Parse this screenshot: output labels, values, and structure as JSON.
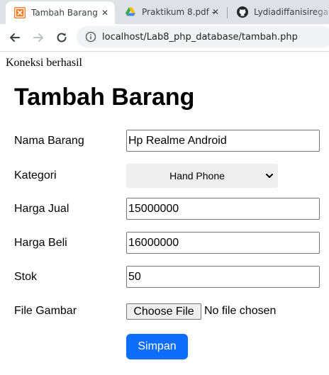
{
  "browser": {
    "tabs": [
      {
        "title": "Tambah Barang",
        "icon": "xampp-icon",
        "active": true
      },
      {
        "title": "Praktikum 8.pdf -",
        "icon": "google-drive-icon",
        "active": false
      },
      {
        "title": "Lydiadiffanisirega",
        "icon": "github-icon",
        "active": false
      }
    ],
    "close_glyph": "✕",
    "url": "localhost/Lab8_php_database/tambah.php"
  },
  "page": {
    "status_text": "Koneksi berhasil",
    "title": "Tambah Barang",
    "form": {
      "nama_label": "Nama Barang",
      "nama_value": "Hp Realme Android",
      "kategori_label": "Kategori",
      "kategori_selected": "Hand Phone",
      "harga_jual_label": "Harga Jual",
      "harga_jual_value": "15000000",
      "harga_beli_label": "Harga Beli",
      "harga_beli_value": "16000000",
      "stok_label": "Stok",
      "stok_value": "50",
      "file_label": "File Gambar",
      "file_button_label": "Choose File",
      "file_status": "No file chosen",
      "submit_label": "Simpan"
    }
  },
  "colors": {
    "submit_bg": "#0d6efd",
    "xampp": "#fb7a24",
    "tabstrip": "#dee1e6"
  }
}
